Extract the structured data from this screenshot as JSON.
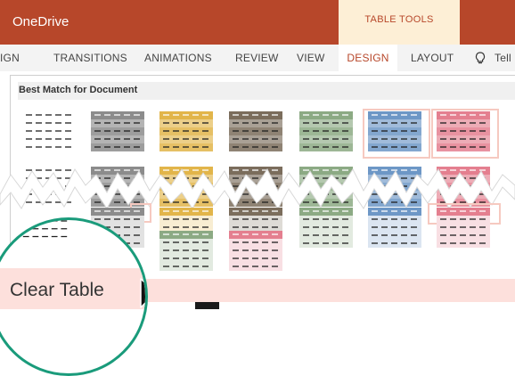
{
  "app": {
    "title": "OneDrive"
  },
  "contextual": {
    "label": "TABLE TOOLS"
  },
  "tabs": [
    {
      "label": "IGN",
      "active": false
    },
    {
      "label": "TRANSITIONS",
      "active": false
    },
    {
      "label": "ANIMATIONS",
      "active": false
    },
    {
      "label": "REVIEW",
      "active": false
    },
    {
      "label": "VIEW",
      "active": false
    },
    {
      "label": "DESIGN",
      "active": true
    },
    {
      "label": "LAYOUT",
      "active": false
    }
  ],
  "tellme": {
    "label": "Tell m"
  },
  "gallery": {
    "title": "Best Match for Document",
    "colors": {
      "plain": "#ffffff",
      "gray": "#8c8c8c",
      "gold": "#e2b54a",
      "brown": "#7b6d5c",
      "green": "#8caa84",
      "blue": "#6d97c6",
      "pink": "#e47f8f",
      "line": "#1f1f1f",
      "highlight": "#f6c9c0"
    }
  },
  "menu": {
    "clear_label": "Clear Table"
  },
  "accent": {
    "magnifier_ring": "#1a9b7b",
    "clear_bg": "#fde0dc",
    "title_bar": "#b7472a",
    "contextual_bg": "#fdefd6"
  }
}
